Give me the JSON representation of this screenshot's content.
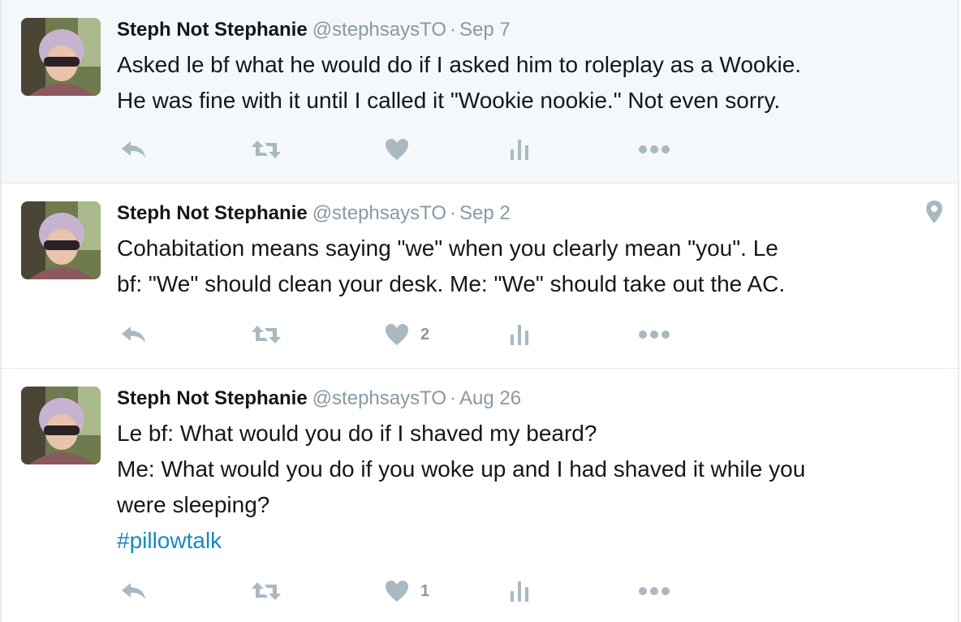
{
  "tweets": [
    {
      "name": "Steph Not Stephanie",
      "handle": "@stephsaysTO",
      "separator": "·",
      "date": "Sep 7",
      "lines": [
        "Asked le bf what he would do if I asked him to roleplay as a Wookie.",
        "He was fine with it until I called it \"Wookie nookie.\" Not even sorry."
      ],
      "like_count": "",
      "has_location_pin": false
    },
    {
      "name": "Steph Not Stephanie",
      "handle": "@stephsaysTO",
      "separator": "·",
      "date": "Sep 2",
      "lines": [
        "Cohabitation means saying \"we\" when you clearly mean \"you\". Le",
        "bf: \"We\" should clean your desk. Me: \"We\" should take out the AC."
      ],
      "like_count": "2",
      "has_location_pin": true
    },
    {
      "name": "Steph Not Stephanie",
      "handle": "@stephsaysTO",
      "separator": "·",
      "date": "Aug 26",
      "lines": [
        "Le bf: What would you do if I shaved my beard?",
        "Me: What would you do if you woke up and I had shaved it while you",
        "were sleeping?"
      ],
      "hashtag": "#pillowtalk",
      "like_count": "1",
      "has_location_pin": false
    }
  ],
  "icons": {
    "reply": "reply-icon",
    "retweet": "retweet-icon",
    "like": "heart-icon",
    "analytics": "analytics-icon",
    "more": "more-icon",
    "location": "location-pin-icon"
  },
  "colors": {
    "highlight_background": "#f5f8fa",
    "secondary_text": "#8899a6",
    "action_icon": "#aab8c2",
    "hashtag": "#1b88c0"
  }
}
